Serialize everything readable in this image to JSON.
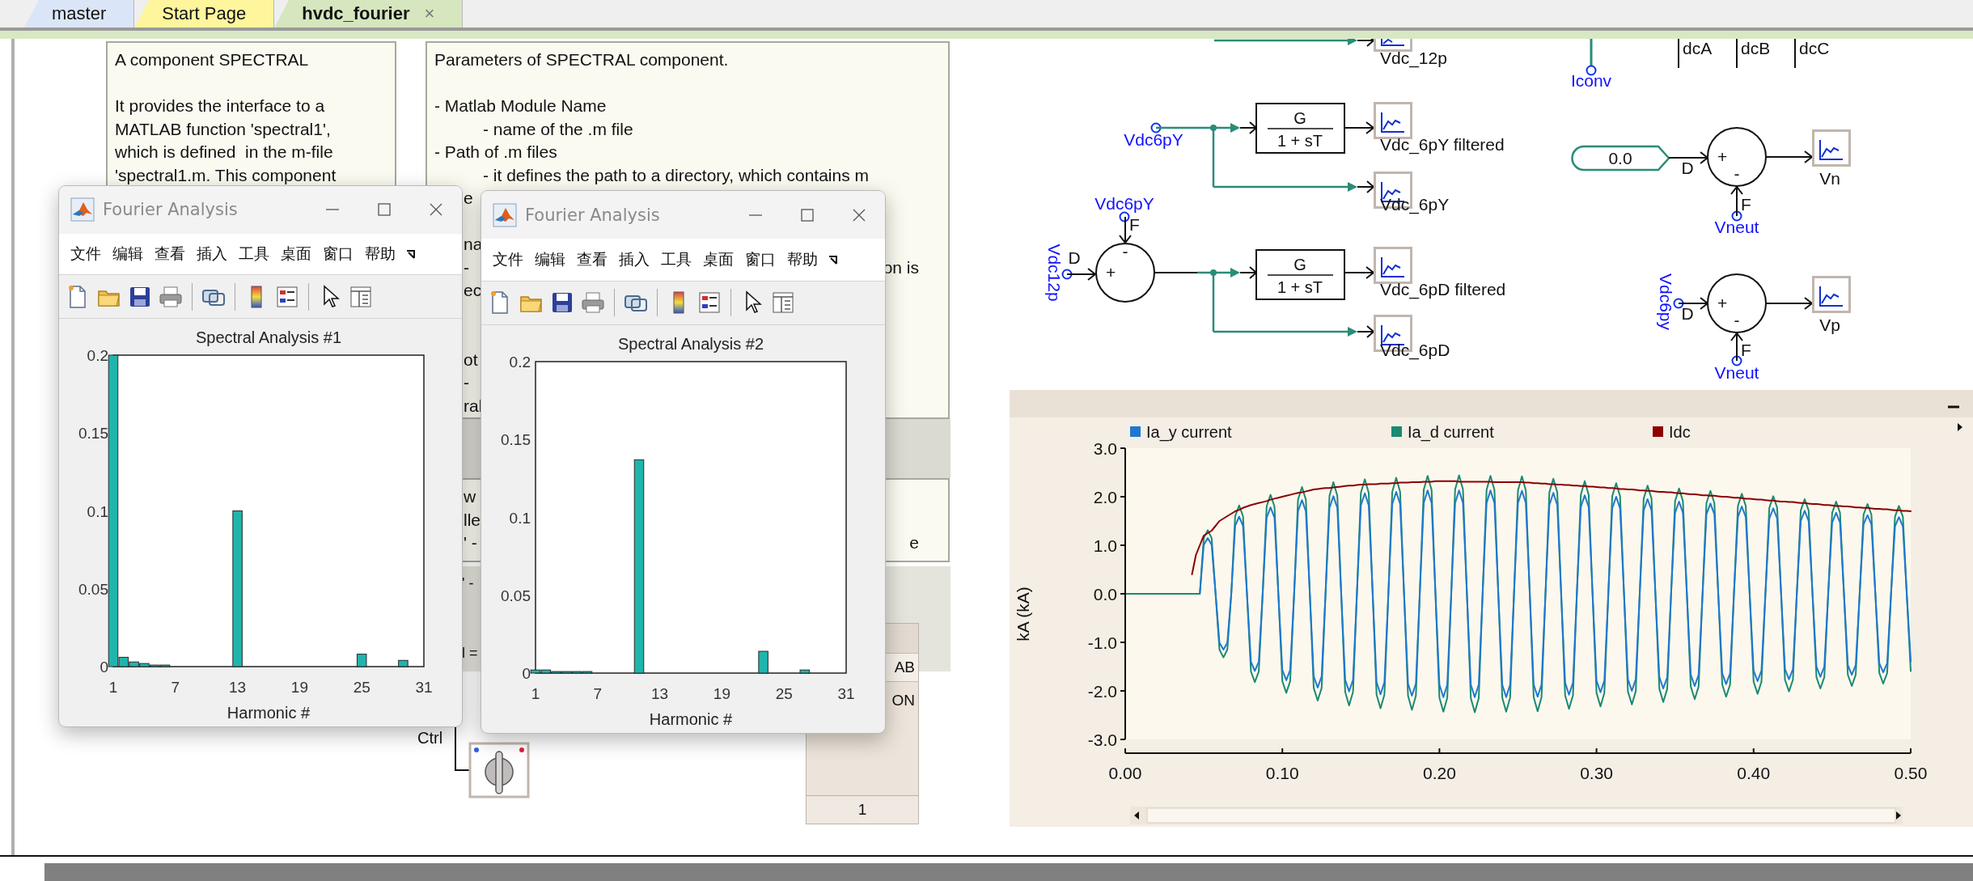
{
  "tabs": [
    {
      "label": "master",
      "selected": false,
      "color": "#dae6f7"
    },
    {
      "label": "Start Page",
      "selected": false,
      "color": "#fff59d"
    },
    {
      "label": "hvdc_fourier",
      "selected": true,
      "color": "#d6e6be",
      "close": "×"
    }
  ],
  "notes": [
    {
      "lines": [
        {
          "kind": "line",
          "text": "A component SPECTRAL"
        },
        {
          "kind": "blank"
        },
        {
          "kind": "line",
          "text": "It provides the interface to a"
        },
        {
          "kind": "line",
          "text": "MATLAB function 'spectral1',"
        },
        {
          "kind": "line",
          "text": "which is defined  in the m-file"
        },
        {
          "kind": "line",
          "text": "'spectral1.m. This component"
        }
      ]
    },
    {
      "lines": [
        {
          "kind": "line",
          "text": "Parameters of SPECTRAL component."
        },
        {
          "kind": "blank"
        },
        {
          "kind": "line",
          "text": "- Matlab Module Name"
        },
        {
          "kind": "sub",
          "text": "- name of the .m file"
        },
        {
          "kind": "line",
          "text": "- Path of .m files"
        },
        {
          "kind": "sub",
          "text": "- it defines the path to a directory, which contains m"
        },
        {
          "kind": "fragment",
          "text": "e"
        },
        {
          "kind": "blank"
        },
        {
          "kind": "fragment",
          "text": "na"
        },
        {
          "kind": "fragment",
          "text": "-",
          "right": "on is"
        },
        {
          "kind": "fragment",
          "text": "ec"
        },
        {
          "kind": "blank"
        },
        {
          "kind": "blank"
        },
        {
          "kind": "fragment",
          "text": "ot"
        },
        {
          "kind": "fragment",
          "text": "-"
        },
        {
          "kind": "fragment",
          "text": "ral"
        }
      ]
    },
    {
      "lines": [
        {
          "kind": "fragment",
          "text": "w"
        },
        {
          "kind": "fragment",
          "text": "lle"
        },
        {
          "kind": "fragment",
          "text": "' -",
          "right": "e"
        }
      ]
    },
    {
      "lines": [
        {
          "kind": "fragment",
          "text": "' -"
        },
        {
          "kind": "blank"
        },
        {
          "kind": "blank"
        },
        {
          "kind": "fragment",
          "text": "l ="
        }
      ]
    }
  ],
  "control_panel": {
    "header": "AB",
    "state": "ON",
    "value": "1"
  },
  "switch": {
    "label": "Ctrl"
  },
  "windows": [
    {
      "title": "Fourier Analysis",
      "menu": [
        "文件",
        "编辑",
        "查看",
        "插入",
        "工具",
        "桌面",
        "窗口",
        "帮助"
      ],
      "chart_data": {
        "type": "bar",
        "title": "Spectral Analysis #1",
        "xlabel": "Harmonic #",
        "x": [
          1,
          2,
          3,
          4,
          5,
          6,
          13,
          25,
          29
        ],
        "values": [
          0.2,
          0.006,
          0.003,
          0.002,
          0.001,
          0.001,
          0.1,
          0.008,
          0.004
        ],
        "xlim": [
          1,
          31
        ],
        "ylim": [
          0,
          0.2
        ],
        "xticks": [
          1,
          7,
          13,
          19,
          25,
          31
        ],
        "yticks": [
          0,
          0.05,
          0.1,
          0.15,
          0.2
        ]
      }
    },
    {
      "title": "Fourier Analysis",
      "menu": [
        "文件",
        "编辑",
        "查看",
        "插入",
        "工具",
        "桌面",
        "窗口",
        "帮助"
      ],
      "chart_data": {
        "type": "bar",
        "title": "Spectral Analysis #2",
        "xlabel": "Harmonic #",
        "x": [
          1,
          2,
          3,
          4,
          5,
          6,
          11,
          23,
          27
        ],
        "values": [
          0.002,
          0.002,
          0.001,
          0.001,
          0.001,
          0.001,
          0.137,
          0.014,
          0.002
        ],
        "xlim": [
          1,
          31
        ],
        "ylim": [
          0,
          0.2
        ],
        "xticks": [
          1,
          7,
          13,
          19,
          25,
          31
        ],
        "yticks": [
          0,
          0.05,
          0.1,
          0.15,
          0.2
        ]
      }
    }
  ],
  "diagram": {
    "scopes": [
      {
        "label": "Vdc_12p"
      },
      {
        "label": "Vdc_6pY filtered"
      },
      {
        "label": "Vdc_6pY"
      },
      {
        "label": "Vdc_6pD filtered"
      },
      {
        "label": "Vdc_6pD"
      },
      {
        "label": "Vn"
      },
      {
        "label": "Vp"
      }
    ],
    "filters": [
      {
        "numerator": "G",
        "denominator": "1 + sT"
      },
      {
        "numerator": "G",
        "denominator": "1 + sT"
      }
    ],
    "signals": [
      {
        "label": "Vdc6pY"
      },
      {
        "label": "Vdc6pY"
      },
      {
        "label": "Vdc12p"
      },
      {
        "label": "Vneut"
      },
      {
        "label": "Vdc6py"
      },
      {
        "label": "Vneut"
      },
      {
        "label": "Iconv"
      }
    ],
    "summers": [
      {
        "plus": "+",
        "minus": "-",
        "port_d": "D",
        "port_f": "F"
      },
      {
        "plus": "+",
        "minus": "-",
        "port_d": "D",
        "port_f": "F"
      },
      {
        "plus": "+",
        "minus": "-",
        "port_d": "D",
        "port_f": "F"
      }
    ],
    "constant": {
      "value": "0.0"
    },
    "buses": [
      {
        "label": "dcA"
      },
      {
        "label": "dcB"
      },
      {
        "label": "dcC"
      }
    ]
  },
  "plot": {
    "chart_data": {
      "type": "line",
      "legend": "top",
      "ylabel": "kA (kA)",
      "xlim": [
        0,
        0.5
      ],
      "ylim": [
        -3,
        3
      ],
      "xticks": [
        {
          "value": 0,
          "label": "0.00"
        },
        {
          "value": 0.1,
          "label": "0.10"
        },
        {
          "value": 0.2,
          "label": "0.20"
        },
        {
          "value": 0.3,
          "label": "0.30"
        },
        {
          "value": 0.4,
          "label": "0.40"
        },
        {
          "value": 0.5,
          "label": "0.50"
        }
      ],
      "yticks": [
        {
          "value": 3,
          "label": "3.0"
        },
        {
          "value": 2,
          "label": "2.0"
        },
        {
          "value": 1,
          "label": "1.0"
        },
        {
          "value": 0,
          "label": "0.0"
        },
        {
          "value": -1,
          "label": "-1.0"
        },
        {
          "value": -2,
          "label": "-2.0"
        },
        {
          "value": -3,
          "label": "-3.0"
        }
      ],
      "x": [
        0,
        0.0025,
        0.005,
        0.0075,
        0.01,
        0.0125,
        0.015,
        0.0175,
        0.02,
        0.0225,
        0.025,
        0.0275,
        0.03,
        0.0325,
        0.035,
        0.0375,
        0.04,
        0.0425,
        0.045,
        0.0475,
        0.05,
        0.0525,
        0.055,
        0.0575,
        0.06,
        0.0625,
        0.065,
        0.0675,
        0.07,
        0.0725,
        0.075,
        0.0775,
        0.08,
        0.0825,
        0.085,
        0.0875,
        0.09,
        0.0925,
        0.095,
        0.0975,
        0.1,
        0.1025,
        0.105,
        0.1075,
        0.11,
        0.1125,
        0.115,
        0.1175,
        0.12,
        0.1225,
        0.125,
        0.1275,
        0.13,
        0.1325,
        0.135,
        0.1375,
        0.14,
        0.1425,
        0.145,
        0.1475,
        0.15,
        0.1525,
        0.155,
        0.1575,
        0.16,
        0.1625,
        0.165,
        0.1675,
        0.17,
        0.1725,
        0.175,
        0.1775,
        0.18,
        0.1825,
        0.185,
        0.1875,
        0.19,
        0.1925,
        0.195,
        0.1975,
        0.2,
        0.2025,
        0.205,
        0.2075,
        0.21,
        0.2125,
        0.215,
        0.2175,
        0.22,
        0.2225,
        0.225,
        0.2275,
        0.23,
        0.2325,
        0.235,
        0.2375,
        0.24,
        0.2425,
        0.245,
        0.2475,
        0.25,
        0.2525,
        0.255,
        0.2575,
        0.26,
        0.2625,
        0.265,
        0.2675,
        0.27,
        0.2725,
        0.275,
        0.2775,
        0.28,
        0.2825,
        0.285,
        0.2875,
        0.29,
        0.2925,
        0.295,
        0.2975,
        0.3,
        0.3025,
        0.305,
        0.3075,
        0.31,
        0.3125,
        0.315,
        0.3175,
        0.32,
        0.3225,
        0.325,
        0.3275,
        0.33,
        0.3325,
        0.335,
        0.3375,
        0.34,
        0.3425,
        0.345,
        0.3475,
        0.35,
        0.3525,
        0.355,
        0.3575,
        0.36,
        0.3625,
        0.365,
        0.3675,
        0.37,
        0.3725,
        0.375,
        0.3775,
        0.38,
        0.3825,
        0.385,
        0.3875,
        0.39,
        0.3925,
        0.395,
        0.3975,
        0.4,
        0.4025,
        0.405,
        0.4075,
        0.41,
        0.4125,
        0.415,
        0.4175,
        0.42,
        0.4225,
        0.425,
        0.4275,
        0.43,
        0.4325,
        0.435,
        0.4375,
        0.44,
        0.4425,
        0.445,
        0.4475,
        0.45,
        0.4525,
        0.455,
        0.4575,
        0.46,
        0.4625,
        0.465,
        0.4675,
        0.47,
        0.4725,
        0.475,
        0.4775,
        0.48,
        0.4825,
        0.485,
        0.4875,
        0.49,
        0.4925,
        0.495,
        0.4975,
        0.5
      ],
      "series": [
        {
          "name": "Ia_y current",
          "color": "#1f78d0",
          "values": [
            null,
            null,
            null,
            null,
            null,
            null,
            null,
            null,
            null,
            null,
            null,
            null,
            null,
            null,
            null,
            null,
            null,
            null,
            null,
            0,
            1.01,
            1.15,
            1.01,
            0,
            -1.01,
            -1.15,
            -1.01,
            0,
            1.4,
            1.59,
            1.4,
            0,
            -1.4,
            -1.59,
            -1.4,
            0,
            1.57,
            1.78,
            1.57,
            0,
            -1.57,
            -1.78,
            -1.57,
            0,
            1.7,
            1.93,
            1.7,
            0,
            -1.7,
            -1.93,
            -1.7,
            0,
            1.77,
            2.01,
            1.77,
            0,
            -1.77,
            -2.01,
            -1.77,
            0,
            1.82,
            2.07,
            1.82,
            0,
            -1.82,
            -2.07,
            -1.82,
            0,
            1.85,
            2.1,
            1.85,
            0,
            -1.85,
            -2.1,
            -1.85,
            0,
            1.87,
            2.13,
            1.87,
            0,
            -1.87,
            -2.13,
            -1.87,
            0,
            1.87,
            2.13,
            1.87,
            0,
            -1.87,
            -2.13,
            -1.87,
            0,
            1.87,
            2.13,
            1.87,
            0,
            -1.87,
            -2.13,
            -1.87,
            0,
            1.87,
            2.12,
            1.87,
            0,
            -1.87,
            -2.12,
            -1.87,
            0,
            1.83,
            2.08,
            1.83,
            0,
            -1.83,
            -2.08,
            -1.83,
            0,
            1.79,
            2.03,
            1.79,
            0,
            -1.79,
            -2.03,
            -1.79,
            0,
            1.76,
            2.0,
            1.76,
            0,
            -1.76,
            -2.0,
            -1.76,
            0,
            1.72,
            1.95,
            1.72,
            0,
            -1.72,
            -1.95,
            -1.72,
            0,
            1.67,
            1.9,
            1.67,
            0,
            -1.67,
            -1.9,
            -1.67,
            0,
            1.64,
            1.86,
            1.64,
            0,
            -1.64,
            -1.86,
            -1.64,
            0,
            1.58,
            1.8,
            1.58,
            0,
            -1.58,
            -1.8,
            -1.58,
            0,
            1.55,
            1.76,
            1.55,
            0,
            -1.55,
            -1.76,
            -1.55,
            0,
            1.5,
            1.71,
            1.5,
            0,
            -1.5,
            -1.71,
            -1.5,
            0,
            1.47,
            1.67,
            1.47,
            0,
            -1.47,
            -1.67,
            -1.47,
            0,
            1.43,
            1.62,
            1.43,
            0,
            -1.43,
            -1.62,
            -1.43,
            0,
            1.39,
            1.58,
            1.39,
            0,
            -1.39
          ]
        },
        {
          "name": "Ia_d current",
          "color": "#1a8a70",
          "values": [
            0,
            0,
            0,
            0,
            0,
            0,
            0,
            0,
            0,
            0,
            0,
            0,
            0,
            0,
            0,
            0,
            0,
            0,
            0,
            0,
            1.15,
            1.31,
            1.15,
            0,
            -1.15,
            -1.31,
            -1.15,
            0,
            1.6,
            1.82,
            1.6,
            0,
            -1.6,
            -1.82,
            -1.6,
            0,
            1.8,
            2.04,
            1.8,
            0,
            -1.8,
            -2.04,
            -1.8,
            0,
            1.94,
            2.2,
            1.94,
            0,
            -1.94,
            -2.2,
            -1.94,
            0,
            2.02,
            2.3,
            2.02,
            0,
            -2.02,
            -2.3,
            -2.02,
            0,
            2.08,
            2.36,
            2.08,
            0,
            -2.08,
            -2.36,
            -2.08,
            0,
            2.1,
            2.39,
            2.1,
            0,
            -2.1,
            -2.39,
            -2.1,
            0,
            2.14,
            2.43,
            2.14,
            0,
            -2.14,
            -2.43,
            -2.14,
            0,
            2.15,
            2.44,
            2.15,
            0,
            -2.15,
            -2.44,
            -2.15,
            0,
            2.14,
            2.43,
            2.14,
            0,
            -2.14,
            -2.43,
            -2.14,
            0,
            2.13,
            2.42,
            2.13,
            0,
            -2.13,
            -2.42,
            -2.13,
            0,
            2.09,
            2.37,
            2.09,
            0,
            -2.09,
            -2.37,
            -2.09,
            0,
            2.04,
            2.32,
            2.04,
            0,
            -2.04,
            -2.32,
            -2.04,
            0,
            2.01,
            2.28,
            2.01,
            0,
            -2.01,
            -2.28,
            -2.01,
            0,
            1.96,
            2.23,
            1.96,
            0,
            -1.96,
            -2.23,
            -1.96,
            0,
            1.91,
            2.17,
            1.91,
            0,
            -1.91,
            -2.17,
            -1.91,
            0,
            1.87,
            2.12,
            1.87,
            0,
            -1.87,
            -2.12,
            -1.87,
            0,
            1.81,
            2.06,
            1.81,
            0,
            -1.81,
            -2.06,
            -1.81,
            0,
            1.77,
            2.01,
            1.77,
            0,
            -1.77,
            -2.01,
            -1.77,
            0,
            1.72,
            1.95,
            1.72,
            0,
            -1.72,
            -1.95,
            -1.72,
            0,
            1.67,
            1.9,
            1.67,
            0,
            -1.67,
            -1.9,
            -1.67,
            0,
            1.63,
            1.85,
            1.63,
            0,
            -1.63,
            -1.85,
            -1.63,
            0,
            1.59,
            1.81,
            1.59,
            0,
            -1.59
          ]
        },
        {
          "name": "Idc",
          "color": "#8b0000",
          "values": [
            null,
            null,
            null,
            null,
            null,
            null,
            null,
            null,
            null,
            null,
            null,
            null,
            null,
            null,
            null,
            null,
            null,
            0.4,
            0.8,
            1.0,
            1.2,
            1.25,
            1.3,
            1.4,
            1.5,
            1.55,
            1.6,
            1.65,
            1.7,
            1.73,
            1.77,
            1.8,
            1.83,
            1.85,
            1.87,
            1.89,
            1.91,
            1.94,
            1.96,
            1.98,
            2.0,
            2.02,
            2.04,
            2.06,
            2.08,
            2.09,
            2.11,
            2.13,
            2.15,
            2.16,
            2.17,
            2.18,
            2.18,
            2.19,
            2.2,
            2.21,
            2.22,
            2.23,
            2.23,
            2.24,
            2.25,
            2.25,
            2.26,
            2.26,
            2.26,
            2.27,
            2.27,
            2.27,
            2.28,
            2.28,
            2.29,
            2.29,
            2.29,
            2.3,
            2.3,
            2.3,
            2.31,
            2.31,
            2.31,
            2.32,
            2.32,
            2.32,
            2.32,
            2.32,
            2.32,
            2.31,
            2.31,
            2.31,
            2.31,
            2.31,
            2.31,
            2.31,
            2.31,
            2.31,
            2.3,
            2.3,
            2.3,
            2.3,
            2.3,
            2.3,
            2.3,
            2.3,
            2.29,
            2.29,
            2.28,
            2.28,
            2.27,
            2.27,
            2.26,
            2.26,
            2.25,
            2.25,
            2.24,
            2.24,
            2.23,
            2.23,
            2.22,
            2.22,
            2.21,
            2.21,
            2.2,
            2.19,
            2.19,
            2.18,
            2.18,
            2.17,
            2.16,
            2.16,
            2.15,
            2.15,
            2.14,
            2.13,
            2.13,
            2.12,
            2.12,
            2.11,
            2.1,
            2.1,
            2.09,
            2.09,
            2.08,
            2.07,
            2.07,
            2.06,
            2.05,
            2.05,
            2.04,
            2.03,
            2.03,
            2.02,
            2.02,
            2.01,
            2.0,
            2.0,
            1.99,
            1.98,
            1.98,
            1.97,
            1.96,
            1.96,
            1.95,
            1.94,
            1.94,
            1.93,
            1.92,
            1.92,
            1.91,
            1.9,
            1.9,
            1.89,
            1.89,
            1.88,
            1.87,
            1.87,
            1.86,
            1.85,
            1.85,
            1.84,
            1.83,
            1.83,
            1.82,
            1.81,
            1.81,
            1.8,
            1.8,
            1.79,
            1.78,
            1.78,
            1.77,
            1.77,
            1.76,
            1.75,
            1.75,
            1.74,
            1.74,
            1.73,
            1.72,
            1.72,
            1.71,
            1.71,
            1.7
          ]
        }
      ]
    }
  }
}
